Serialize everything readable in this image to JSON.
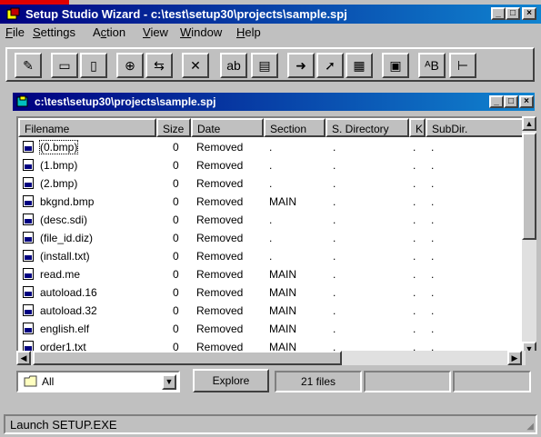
{
  "window": {
    "title": "Setup Studio Wizard - c:\\test\\setup30\\projects\\sample.spj",
    "min_label": "_",
    "max_label": "□",
    "close_label": "×"
  },
  "menu": [
    {
      "label": "File",
      "u": "F",
      "rest": "ile"
    },
    {
      "label": "Settings",
      "u": "S",
      "rest": "ettings"
    },
    {
      "label": "Action",
      "u": "c",
      "pre": "A",
      "rest": "tion"
    },
    {
      "label": "View",
      "u": "V",
      "rest": "iew"
    },
    {
      "label": "Window",
      "u": "W",
      "rest": "indow"
    },
    {
      "label": "Help",
      "u": "H",
      "rest": "elp"
    }
  ],
  "toolbar": {
    "buttons": [
      {
        "name": "wizard-icon",
        "glyph": "✎"
      },
      {
        "name": "open-icon",
        "glyph": "▭"
      },
      {
        "name": "new-icon",
        "glyph": "▯"
      },
      {
        "name": "add-files-icon",
        "glyph": "⊕"
      },
      {
        "name": "move-icon",
        "glyph": "⇆"
      },
      {
        "name": "delete-icon",
        "glyph": "✕"
      },
      {
        "name": "rename-icon",
        "glyph": "ab"
      },
      {
        "name": "properties-icon",
        "glyph": "▤"
      },
      {
        "name": "build-icon",
        "glyph": "➜"
      },
      {
        "name": "test-icon",
        "glyph": "➚"
      },
      {
        "name": "calendar-icon",
        "glyph": "▦"
      },
      {
        "name": "compress-icon",
        "glyph": "▣"
      },
      {
        "name": "sort-icon",
        "glyph": "ᴬB"
      },
      {
        "name": "tree-icon",
        "glyph": "⊢"
      }
    ]
  },
  "child_window": {
    "title": "c:\\test\\setup30\\projects\\sample.spj"
  },
  "list": {
    "headers": [
      "Filename",
      "Size",
      "Date",
      "Section",
      "S. Directory",
      "K",
      "SubDir."
    ],
    "rows": [
      {
        "filename": "(0.bmp)",
        "size": "0",
        "date": "Removed",
        "section": ".",
        "sdir": ".",
        "k": ".",
        "subdir": "."
      },
      {
        "filename": "(1.bmp)",
        "size": "0",
        "date": "Removed",
        "section": ".",
        "sdir": ".",
        "k": ".",
        "subdir": "."
      },
      {
        "filename": "(2.bmp)",
        "size": "0",
        "date": "Removed",
        "section": ".",
        "sdir": ".",
        "k": ".",
        "subdir": "."
      },
      {
        "filename": "bkgnd.bmp",
        "size": "0",
        "date": "Removed",
        "section": "MAIN",
        "sdir": ".",
        "k": ".",
        "subdir": "."
      },
      {
        "filename": "(desc.sdi)",
        "size": "0",
        "date": "Removed",
        "section": ".",
        "sdir": ".",
        "k": ".",
        "subdir": "."
      },
      {
        "filename": "(file_id.diz)",
        "size": "0",
        "date": "Removed",
        "section": ".",
        "sdir": ".",
        "k": ".",
        "subdir": "."
      },
      {
        "filename": "(install.txt)",
        "size": "0",
        "date": "Removed",
        "section": ".",
        "sdir": ".",
        "k": ".",
        "subdir": "."
      },
      {
        "filename": "read.me",
        "size": "0",
        "date": "Removed",
        "section": "MAIN",
        "sdir": ".",
        "k": ".",
        "subdir": "."
      },
      {
        "filename": "autoload.16",
        "size": "0",
        "date": "Removed",
        "section": "MAIN",
        "sdir": ".",
        "k": ".",
        "subdir": "."
      },
      {
        "filename": "autoload.32",
        "size": "0",
        "date": "Removed",
        "section": "MAIN",
        "sdir": ".",
        "k": ".",
        "subdir": "."
      },
      {
        "filename": "english.elf",
        "size": "0",
        "date": "Removed",
        "section": "MAIN",
        "sdir": ".",
        "k": ".",
        "subdir": "."
      },
      {
        "filename": "order1.txt",
        "size": "0",
        "date": "Removed",
        "section": "MAIN",
        "sdir": ".",
        "k": ".",
        "subdir": "."
      }
    ]
  },
  "bottom": {
    "filter_value": "All",
    "explore_label": "Explore",
    "files_count": "21 files"
  },
  "status": {
    "text": "Launch SETUP.EXE"
  }
}
